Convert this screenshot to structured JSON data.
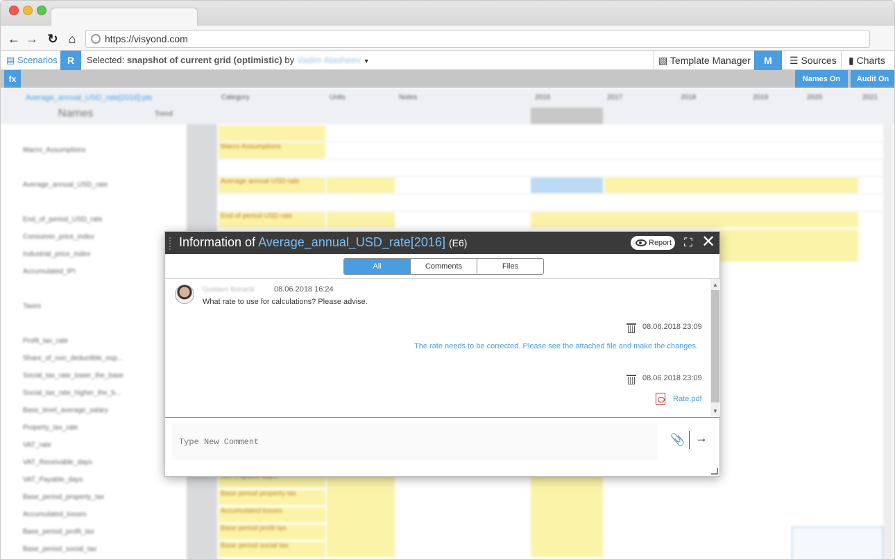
{
  "browser": {
    "url": "https://visyond.com"
  },
  "toolbar": {
    "scenarios_label": "Scenarios",
    "r_label": "R",
    "selected_prefix": "Selected:",
    "selected_value": "snapshot of current grid (optimistic)",
    "by_label": "by",
    "author_blurred": "Vadim Alasheev",
    "template_manager_label": "Template Manager",
    "m_label": "M",
    "sources_label": "Sources",
    "charts_label": "Charts"
  },
  "fxbar": {
    "fx_label": "fx",
    "names_on_label": "Names On",
    "audit_on_label": "Audit On"
  },
  "sheet": {
    "names_header": "Names",
    "trend_header": "Trend",
    "filter_text": "Average_annual_USD_rate[2016]:pts",
    "col_headers": [
      "Category",
      "Units",
      "Notes",
      "",
      "2016",
      "2017",
      "2018",
      "2019",
      "2020",
      "2021"
    ],
    "row_labels": [
      "Macro_Assumptions",
      "Average_annual_USD_rate",
      "End_of_period_USD_rate",
      "Consumer_price_index",
      "Industrial_price_index",
      "Accumulated_IPI",
      "Taxes",
      "Profit_tax_rate",
      "Share_of_non_deductible_exp...",
      "Social_tax_rate_lower_the_base",
      "Social_tax_rate_higher_the_b...",
      "Base_level_average_salary",
      "Property_tax_rate",
      "VAT_rate",
      "VAT_Receivable_days",
      "VAT_Payable_days",
      "Base_period_property_tax",
      "Accumulated_losses",
      "Base_period_profit_tax",
      "Base_period_social_tax"
    ],
    "yellow_labels": [
      "Macro Assumptions",
      "Average annual USD rate",
      "End of period USD rate",
      "VAT Payable days",
      "Base period property tax",
      "Accumulated losses",
      "Base period profit tax",
      "Base period social tax"
    ]
  },
  "modal": {
    "title_prefix": "Information of",
    "title_name": "Average_annual_USD_rate[2016]",
    "title_ref": "(E6)",
    "report_label": "Report",
    "tabs": [
      "All",
      "Comments",
      "Files"
    ],
    "active_tab": "All",
    "comment1": {
      "author": "Gustavo Bonardi",
      "date": "08.06.2018 16:24",
      "text": "What rate to use for calculations? Please advise."
    },
    "comment2": {
      "date": "08.06.2018 23:09",
      "text": "The rate needs to be corrected. Please see the attached file and make the changes."
    },
    "comment3": {
      "date": "08.06.2018 23:09",
      "file": "Rate.pdf"
    },
    "input_placeholder": "Type New Comment"
  },
  "colors": {
    "accent": "#4a9de0",
    "modal_header": "#3a3a3a",
    "cell_yellow": "#fbf3a8"
  }
}
